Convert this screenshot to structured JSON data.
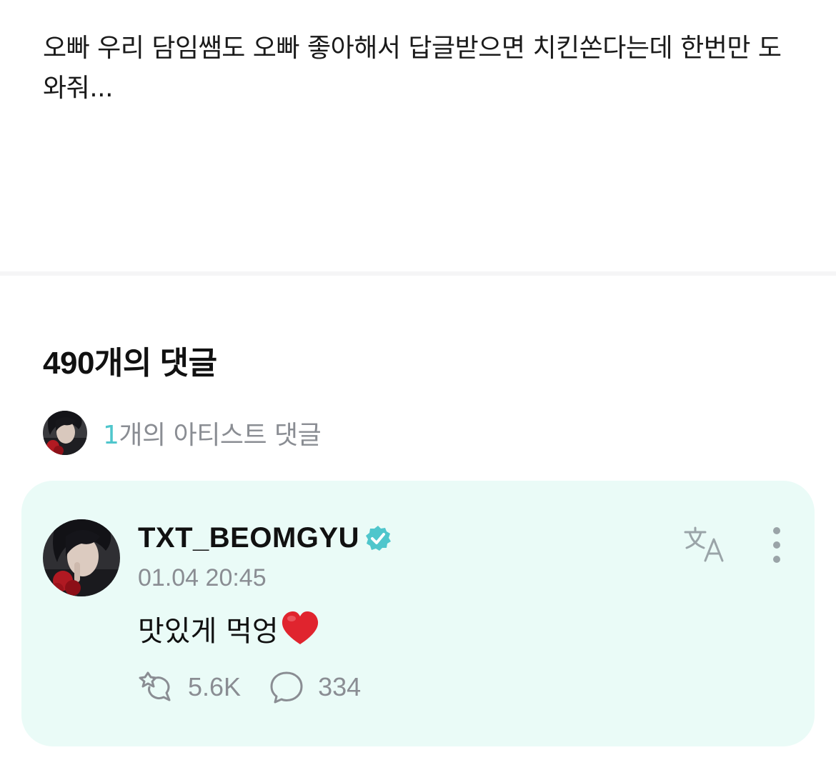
{
  "post": {
    "body": "오빠 우리 담임쌤도 오빠 좋아해서 답글받으면 치킨쏜다는데 한번만 도와줘..."
  },
  "comments_header": {
    "count_label": "490개의 댓글"
  },
  "artist_summary": {
    "count": "1",
    "label": "개의 아티스트 댓글"
  },
  "artist_comment": {
    "username": "TXT_BEOMGYU",
    "verified_icon": "verified-badge-icon",
    "timestamp": "01.04 20:45",
    "text": "맛있게 먹엉",
    "emoji": "heart-emoji",
    "likes": "5.6K",
    "replies": "334",
    "translate_icon": "translate-icon",
    "more_icon": "more-vertical-icon"
  },
  "colors": {
    "accent": "#4fc6cc",
    "card_background": "#eafbf7",
    "muted_text": "#8a8d93",
    "heart": "#e0242e"
  }
}
